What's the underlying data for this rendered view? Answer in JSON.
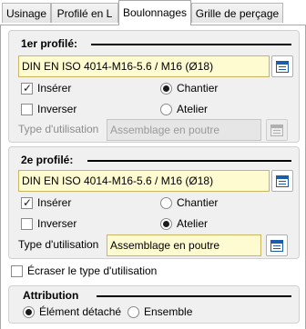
{
  "tabs": [
    {
      "label": "Usinage"
    },
    {
      "label": "Profilé en L"
    },
    {
      "label": "Boulonnages"
    },
    {
      "label": "Grille de perçage"
    }
  ],
  "profile1": {
    "title": "1er profilé:",
    "bolt": "DIN EN ISO 4014-M16-5.6 / M16 (Ø18)",
    "insert_label": "Insérer",
    "invert_label": "Inverser",
    "site_label": "Chantier",
    "workshop_label": "Atelier",
    "usage_label": "Type d'utilisation",
    "usage_value": "Assemblage en poutre"
  },
  "profile2": {
    "title": "2e profilé:",
    "bolt": "DIN EN ISO 4014-M16-5.6 / M16 (Ø18)",
    "insert_label": "Insérer",
    "invert_label": "Inverser",
    "site_label": "Chantier",
    "workshop_label": "Atelier",
    "usage_label": "Type d'utilisation",
    "usage_value": "Assemblage en poutre"
  },
  "overwrite_label": "Écraser le type d'utilisation",
  "attribution": {
    "title": "Attribution",
    "detached_label": "Élément détaché",
    "assembly_label": "Ensemble"
  }
}
